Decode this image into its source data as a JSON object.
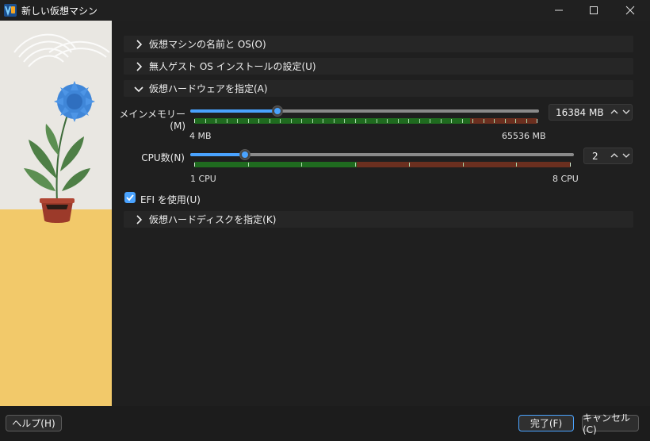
{
  "window": {
    "title": "新しい仮想マシン",
    "controls": [
      "minimize-icon",
      "maximize-icon",
      "close-icon"
    ]
  },
  "sections": {
    "name_os": {
      "label": "仮想マシンの名前と OS(O)",
      "expanded": false
    },
    "unattended": {
      "label": "無人ゲスト OS インストールの設定(U)",
      "expanded": false
    },
    "hardware": {
      "label": "仮想ハードウェアを指定(A)",
      "expanded": true
    },
    "disk": {
      "label": "仮想ハードディスクを指定(K)",
      "expanded": false
    }
  },
  "hardware": {
    "memory": {
      "label": "メインメモリー(M)",
      "value": "16384 MB",
      "min_label": "4 MB",
      "max_label": "65536 MB",
      "fraction": 0.25
    },
    "cpu": {
      "label": "CPU数(N)",
      "value": "2",
      "min_label": "1 CPU",
      "max_label": "8 CPU",
      "fraction": 0.143
    },
    "efi": {
      "label": "EFI を使用(U)",
      "checked": true
    }
  },
  "footer": {
    "help_label": "ヘルプ(H)",
    "finish_label": "完了(F)",
    "cancel_label": "キャンセル(C)"
  },
  "colors": {
    "accent": "#4aa3ff",
    "good_range": "#1f6b1f",
    "warn_range": "#6b2f1f",
    "side_floor": "#f2c96a"
  }
}
